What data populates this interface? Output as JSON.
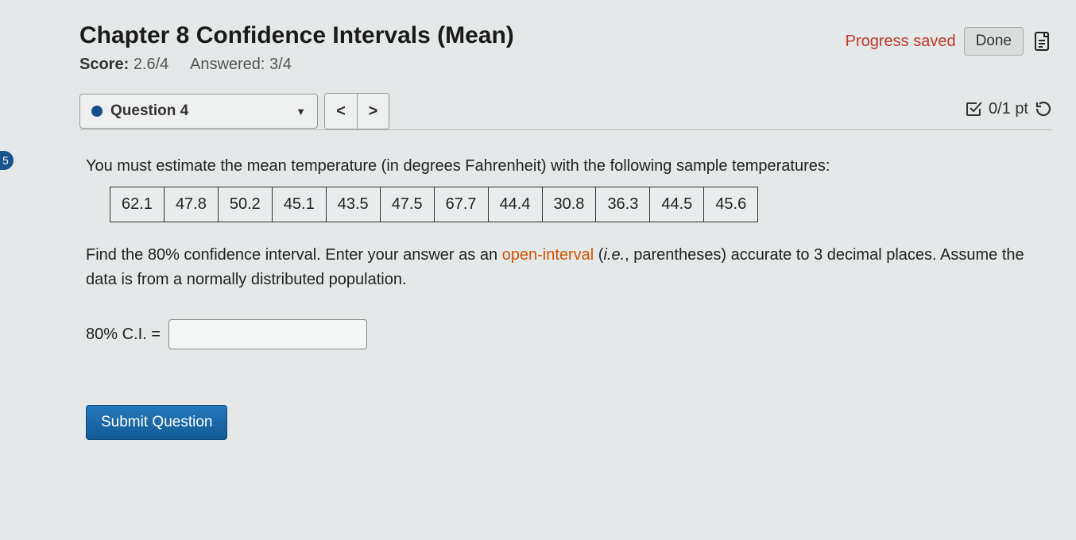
{
  "left_badge": "5",
  "header": {
    "title": "Chapter 8 Confidence Intervals (Mean)",
    "score_label": "Score:",
    "score_value": "2.6/4",
    "answered_label": "Answered:",
    "answered_value": "3/4",
    "progress_saved": "Progress saved",
    "done_label": "Done"
  },
  "qbar": {
    "question_label": "Question 4",
    "prev": "<",
    "next": ">",
    "points": "0/1 pt"
  },
  "problem": {
    "prompt": "You must estimate the mean temperature (in degrees Fahrenheit) with the following sample temperatures:",
    "data": [
      "62.1",
      "47.8",
      "50.2",
      "45.1",
      "43.5",
      "47.5",
      "67.7",
      "44.4",
      "30.8",
      "36.3",
      "44.5",
      "45.6"
    ],
    "instr_pre": "Find the 80% confidence interval. Enter your answer as an ",
    "instr_open": "open-interval",
    "instr_post_a": " (",
    "instr_ie": "i.e.",
    "instr_post_b": ", parentheses) accurate to 3 decimal places. Assume the data is from a normally distributed population.",
    "answer_label": "80% C.I. =",
    "answer_value": ""
  },
  "submit_label": "Submit Question"
}
